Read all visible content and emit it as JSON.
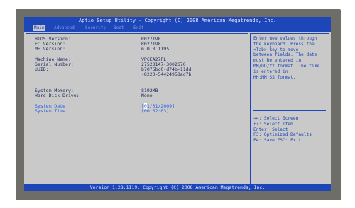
{
  "title": "Aptio Setup Utility - Copyright (C) 2008 American Megatrends, Inc.",
  "tabs": [
    {
      "label": "Main"
    },
    {
      "label": "Advanced"
    },
    {
      "label": "Security"
    },
    {
      "label": "Boot"
    },
    {
      "label": "Exit"
    }
  ],
  "info": {
    "bios_version": {
      "label": "BIOS Version:",
      "value": "R0271V8"
    },
    "ec_version": {
      "label": "EC Version:",
      "value": "R0271V8"
    },
    "me_version": {
      "label": "ME Version:",
      "value": "6.0.3.1195"
    },
    "machine_name": {
      "label": "Machine Name:",
      "value": "VPCEA27FL"
    },
    "serial_number": {
      "label": "Serial Number:",
      "value": "27523147-3002670"
    },
    "uuid": {
      "label": "UUID:",
      "value_line1": "b7075bc0-d74b-11dd",
      "value_line2": "-8220-54424958ad7b"
    },
    "system_memory": {
      "label": "System Memory:",
      "value": "8192MB"
    },
    "hard_disk_drive": {
      "label": "Hard Disk Drive:",
      "value": "None"
    },
    "system_date": {
      "label": "System Date",
      "value_prefix": "[",
      "value_cursor": "0",
      "value_rest": "1/01/2009]"
    },
    "system_time": {
      "label": "System Time",
      "value": "[00:02:03]"
    }
  },
  "help": {
    "lines": [
      "Enter new values through",
      "the keyboard. Press the",
      "<Tab> key to move",
      "between fields. The date",
      "must be entered in",
      "MM/DD/YY format. The time",
      "is entered in",
      "HH:MM:SS format."
    ]
  },
  "keys": {
    "lines": [
      "→←: Select Screen",
      "↑↓: Select Item",
      "Enter: Select",
      "F3: Optimized Defaults",
      "F4: Save  ESC: Exit"
    ]
  },
  "status": "Version 1.28.1119. Copyright (C) 2008 American Megatrends, Inc.",
  "colors": {
    "bar_blue": "#1d47b8",
    "panel_gray": "#c9c9c9",
    "selected_blue": "#2c63e0",
    "frame": "#6e6d68"
  }
}
